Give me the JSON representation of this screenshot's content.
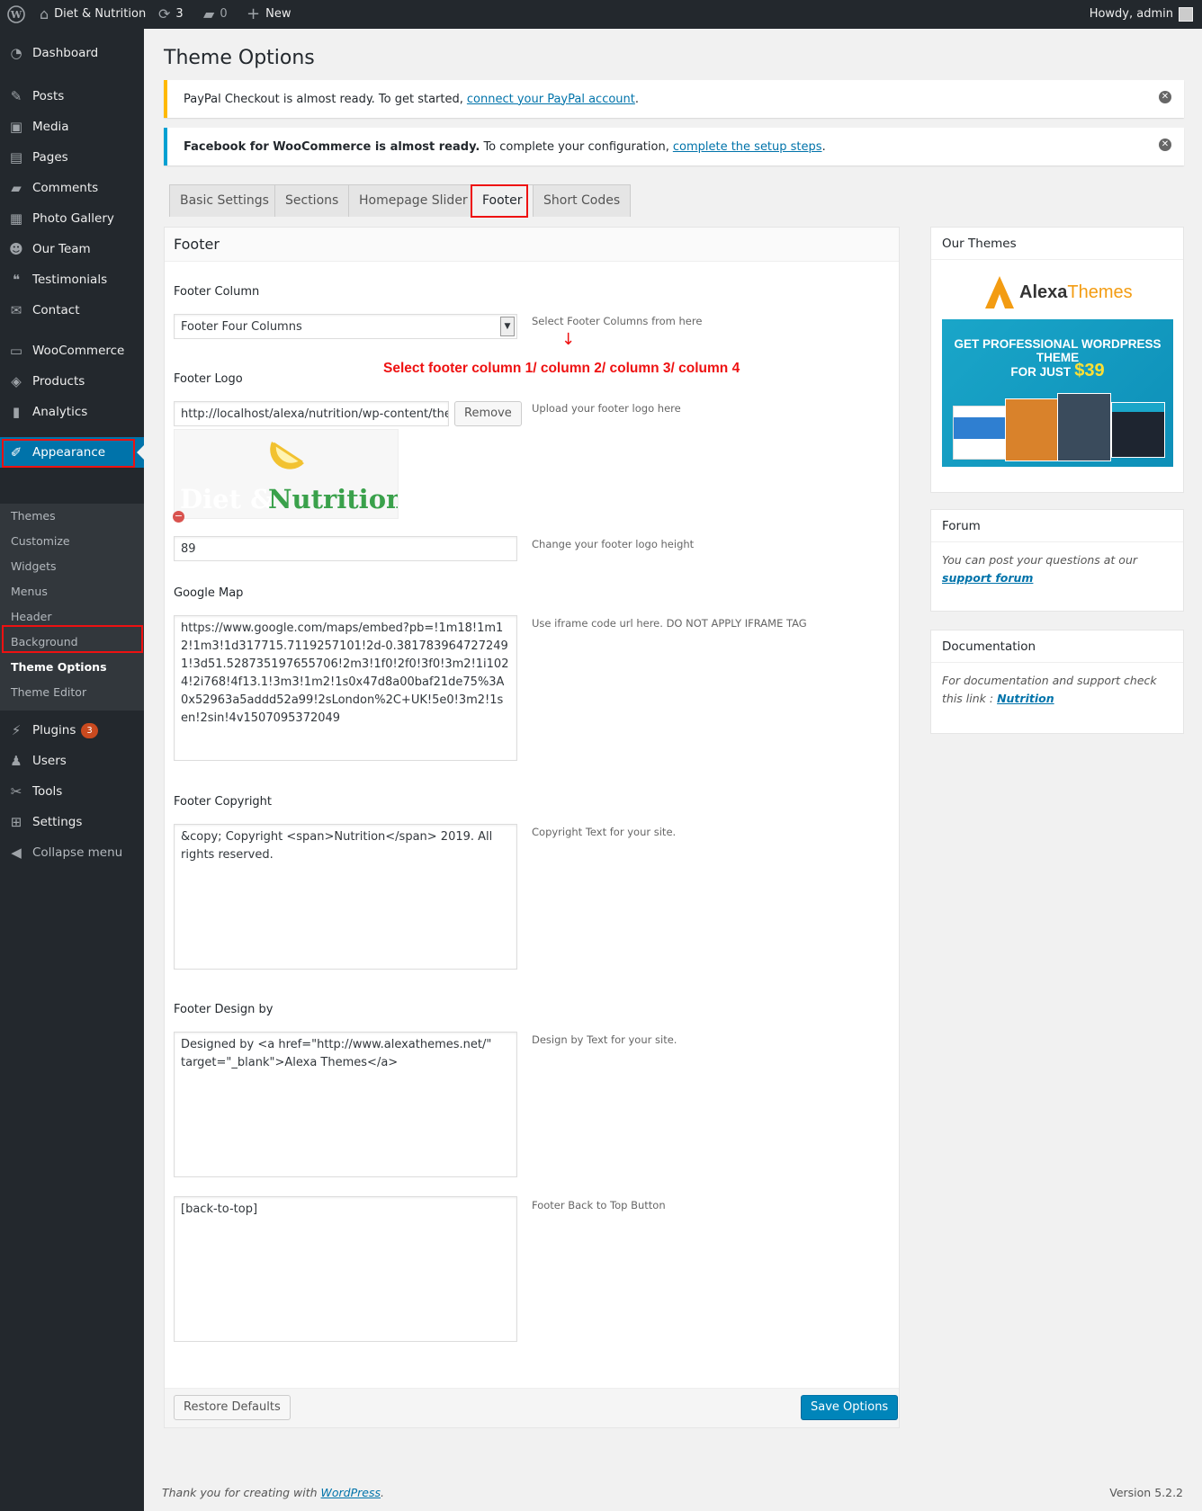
{
  "adminbar": {
    "site_name": "Diet & Nutrition",
    "updates_count": "3",
    "comments_count": "0",
    "new_label": "New",
    "howdy": "Howdy, admin"
  },
  "sidebar": {
    "items": [
      {
        "label": "Dashboard",
        "icon": "dashboard-icon"
      },
      {
        "label": "Posts",
        "icon": "pin-icon"
      },
      {
        "label": "Media",
        "icon": "media-icon"
      },
      {
        "label": "Pages",
        "icon": "pages-icon"
      },
      {
        "label": "Comments",
        "icon": "comment-icon"
      },
      {
        "label": "Photo Gallery",
        "icon": "gallery-icon"
      },
      {
        "label": "Our Team",
        "icon": "team-icon"
      },
      {
        "label": "Testimonials",
        "icon": "quote-icon"
      },
      {
        "label": "Contact",
        "icon": "mail-icon"
      },
      {
        "label": "WooCommerce",
        "icon": "woo-icon"
      },
      {
        "label": "Products",
        "icon": "box-icon"
      },
      {
        "label": "Analytics",
        "icon": "chart-icon"
      },
      {
        "label": "Appearance",
        "icon": "brush-icon"
      },
      {
        "label": "Plugins",
        "icon": "plugin-icon",
        "badge": "3"
      },
      {
        "label": "Users",
        "icon": "user-icon"
      },
      {
        "label": "Tools",
        "icon": "wrench-icon"
      },
      {
        "label": "Settings",
        "icon": "settings-icon"
      },
      {
        "label": "Collapse menu",
        "icon": "collapse-icon"
      }
    ],
    "submenu": [
      "Themes",
      "Customize",
      "Widgets",
      "Menus",
      "Header",
      "Background",
      "Theme Options",
      "Theme Editor"
    ]
  },
  "page": {
    "title": "Theme Options",
    "notice1_text": "PayPal Checkout is almost ready. To get started,",
    "notice1_link": "connect your PayPal account",
    "notice1_end": ".",
    "notice2_bold": "Facebook for WooCommerce is almost ready.",
    "notice2_text": "To complete your configuration,",
    "notice2_link": "complete the setup steps",
    "notice2_end": "."
  },
  "tabs": [
    "Basic Settings",
    "Sections",
    "Homepage Slider",
    "Footer",
    "Short Codes"
  ],
  "panel": {
    "heading": "Footer",
    "footer_column_label": "Footer Column",
    "footer_column_value": "Footer Four Columns",
    "footer_column_desc": "Select Footer Columns from here",
    "annotation": "Select footer column 1/ column 2/ column 3/ column 4",
    "footer_logo_label": "Footer Logo",
    "footer_logo_url": "http://localhost/alexa/nutrition/wp-content/themes",
    "remove_label": "Remove",
    "footer_logo_desc": "Upload your footer logo here",
    "logo_text_1": "Diet &",
    "logo_text_2": "Nutrition",
    "logo_height_value": "89",
    "logo_height_desc": "Change your footer logo height",
    "map_label": "Google Map",
    "map_value": "https://www.google.com/maps/embed?pb=!1m18!1m12!1m3!1d317715.7119257101!2d-0.3817839647272491!3d51.528735197655706!2m3!1f0!2f0!3f0!3m2!1i1024!2i768!4f13.1!3m3!1m2!1s0x47d8a00baf21de75%3A0x52963a5addd52a99!2sLondon%2C+UK!5e0!3m2!1sen!2sin!4v1507095372049",
    "map_desc": "Use iframe code url here. DO NOT APPLY IFRAME TAG",
    "copyright_label": "Footer Copyright",
    "copyright_value": "&copy; Copyright <span>Nutrition</span> 2019. All rights reserved.",
    "copyright_desc": "Copyright Text for your site.",
    "design_label": "Footer Design by",
    "design_value": "Designed by <a href=\"http://www.alexathemes.net/\" target=\"_blank\">Alexa Themes</a>",
    "design_desc": "Design by Text for your site.",
    "backtotop_value": "[back-to-top]",
    "backtotop_desc": "Footer Back to Top Button",
    "restore_label": "Restore Defaults",
    "save_label": "Save Options"
  },
  "side": {
    "our_themes_title": "Our Themes",
    "ad_brand_1": "Alexa",
    "ad_brand_2": "Themes",
    "ad_line1": "GET PROFESSIONAL WORDPRESS THEME",
    "ad_line2": "FOR JUST",
    "ad_price": "$39",
    "forum_title": "Forum",
    "forum_text": "You can post your questions at our",
    "forum_link": "support forum",
    "docs_title": "Documentation",
    "docs_text": "For documentation and support check this link :",
    "docs_link": "Nutrition"
  },
  "footer": {
    "thanks": "Thank you for creating with",
    "wp_link": "WordPress",
    "thanks_end": ".",
    "version": "Version 5.2.2"
  },
  "colors": {
    "accent": "#0073aa",
    "highlight": "#e11111",
    "sidebar": "#23282d"
  }
}
